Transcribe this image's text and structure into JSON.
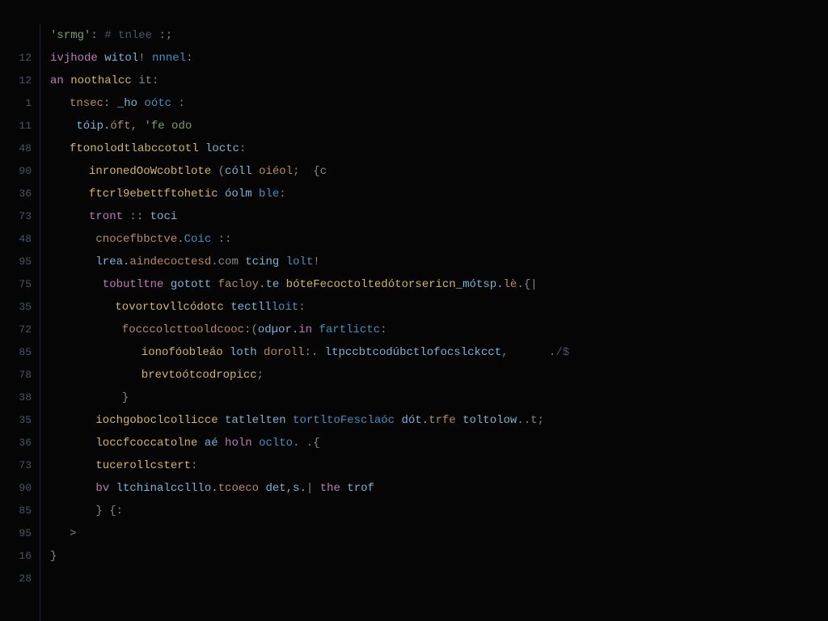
{
  "editor": {
    "line_numbers": [
      "",
      "12",
      "12",
      "1",
      "11",
      "48",
      "90",
      "36",
      "73",
      "48",
      "95",
      "75",
      "35",
      "72",
      "85",
      "78",
      "38",
      "35",
      "36",
      "73",
      "90",
      "85",
      "95",
      "16",
      "28"
    ],
    "lines": [
      {
        "indent": 0,
        "tokens": [
          {
            "t": "'srmg'",
            "c": "tk-string"
          },
          {
            "t": ": ",
            "c": "tk-punct"
          },
          {
            "t": "# tnlee",
            "c": "tk-comment"
          },
          {
            "t": " :;",
            "c": "tk-punct"
          }
        ]
      },
      {
        "indent": 0,
        "tokens": [
          {
            "t": "ivjhode ",
            "c": "tk-keyword"
          },
          {
            "t": "witol",
            "c": "tk-var"
          },
          {
            "t": "! ",
            "c": "tk-punct"
          },
          {
            "t": "nnnel",
            "c": "tk-type"
          },
          {
            "t": ":",
            "c": "tk-punct"
          }
        ]
      },
      {
        "indent": 0,
        "tokens": [
          {
            "t": "an ",
            "c": "tk-keyword"
          },
          {
            "t": "noothalcc",
            "c": "tk-func"
          },
          {
            "t": " it:",
            "c": "tk-punct"
          }
        ]
      },
      {
        "indent": 1,
        "tokens": [
          {
            "t": "tnsec: ",
            "c": "tk-prop"
          },
          {
            "t": "_ho ",
            "c": "tk-var"
          },
          {
            "t": "oótc",
            "c": "tk-type"
          },
          {
            "t": " :",
            "c": "tk-punct"
          }
        ]
      },
      {
        "indent": 1,
        "tokens": [
          {
            "t": " tóip.",
            "c": "tk-var"
          },
          {
            "t": "óft",
            "c": "tk-prop"
          },
          {
            "t": ", ",
            "c": "tk-punct"
          },
          {
            "t": "'fe odo",
            "c": "tk-string"
          }
        ]
      },
      {
        "indent": 1,
        "tokens": [
          {
            "t": "ftonolodtlabccototl ",
            "c": "tk-func"
          },
          {
            "t": "loctc",
            "c": "tk-var"
          },
          {
            "t": ":",
            "c": "tk-punct"
          }
        ]
      },
      {
        "indent": 2,
        "tokens": [
          {
            "t": "inronedOoWcobtlote ",
            "c": "tk-func"
          },
          {
            "t": "(",
            "c": "tk-punct"
          },
          {
            "t": "cóll ",
            "c": "tk-var"
          },
          {
            "t": "oiéol",
            "c": "tk-prop"
          },
          {
            "t": ";  {c",
            "c": "tk-punct"
          }
        ]
      },
      {
        "indent": 2,
        "tokens": [
          {
            "t": "ftcrl9ebettftohetic ",
            "c": "tk-func"
          },
          {
            "t": "óolm ",
            "c": "tk-var"
          },
          {
            "t": "ble",
            "c": "tk-type"
          },
          {
            "t": ":",
            "c": "tk-punct"
          }
        ]
      },
      {
        "indent": 2,
        "tokens": [
          {
            "t": "tront ",
            "c": "tk-keyword"
          },
          {
            "t": ":: ",
            "c": "tk-punct"
          },
          {
            "t": "toci",
            "c": "tk-var"
          }
        ]
      },
      {
        "indent": 2,
        "tokens": [
          {
            "t": " cnocefbbctve.",
            "c": "tk-prop"
          },
          {
            "t": "Coic",
            "c": "tk-type"
          },
          {
            "t": " ::",
            "c": "tk-punct"
          }
        ]
      },
      {
        "indent": 2,
        "tokens": [
          {
            "t": " lrea.",
            "c": "tk-var"
          },
          {
            "t": "aindecoctesd",
            "c": "tk-prop"
          },
          {
            "t": ".com ",
            "c": "tk-punct"
          },
          {
            "t": "tcing ",
            "c": "tk-var"
          },
          {
            "t": "lolt",
            "c": "tk-type"
          },
          {
            "t": "!",
            "c": "tk-punct"
          }
        ]
      },
      {
        "indent": 2,
        "tokens": [
          {
            "t": "  tobutltne ",
            "c": "tk-keyword"
          },
          {
            "t": "gotott ",
            "c": "tk-var"
          },
          {
            "t": "facloy.",
            "c": "tk-prop"
          },
          {
            "t": "te ",
            "c": "tk-var"
          },
          {
            "t": "bóteFecoctoltedótorsericn",
            "c": "tk-func"
          },
          {
            "t": "_mótsp.",
            "c": "tk-var"
          },
          {
            "t": "lè",
            "c": "tk-prop"
          },
          {
            "t": ".{|",
            "c": "tk-punct"
          }
        ]
      },
      {
        "indent": 3,
        "tokens": [
          {
            "t": " tovortovllcódotc ",
            "c": "tk-func"
          },
          {
            "t": "tectll",
            "c": "tk-var"
          },
          {
            "t": "loit",
            "c": "tk-type"
          },
          {
            "t": ":",
            "c": "tk-punct"
          }
        ]
      },
      {
        "indent": 3,
        "tokens": [
          {
            "t": "  focccolcttooldcooc:",
            "c": "tk-prop"
          },
          {
            "t": "(",
            "c": "tk-punct"
          },
          {
            "t": "odµor.",
            "c": "tk-var"
          },
          {
            "t": "in ",
            "c": "tk-keyword"
          },
          {
            "t": "fartlictc",
            "c": "tk-type"
          },
          {
            "t": ":",
            "c": "tk-punct"
          }
        ]
      },
      {
        "indent": 4,
        "tokens": [
          {
            "t": "  ionofóobleáo ",
            "c": "tk-func"
          },
          {
            "t": "loth ",
            "c": "tk-var"
          },
          {
            "t": "doroll:. ",
            "c": "tk-prop"
          },
          {
            "t": "ltpccbtcodúbctlofocslckcct",
            "c": "tk-var"
          },
          {
            "t": ",      .",
            "c": "tk-punct"
          },
          {
            "t": "/$",
            "c": "tk-comment"
          }
        ]
      },
      {
        "indent": 4,
        "tokens": [
          {
            "t": "  brevtoótcodropicc",
            "c": "tk-func"
          },
          {
            "t": ";",
            "c": "tk-punct"
          }
        ]
      },
      {
        "indent": 3,
        "tokens": [
          {
            "t": "  }",
            "c": "tk-punct"
          }
        ]
      },
      {
        "indent": 2,
        "tokens": [
          {
            "t": " iochgoboclcollicce ",
            "c": "tk-func"
          },
          {
            "t": "tatlelten ",
            "c": "tk-var"
          },
          {
            "t": "tortltoFesclaóc ",
            "c": "tk-type"
          },
          {
            "t": "dót.",
            "c": "tk-var"
          },
          {
            "t": "trfe ",
            "c": "tk-prop"
          },
          {
            "t": "toltolow",
            "c": "tk-var"
          },
          {
            "t": "..t;",
            "c": "tk-punct"
          }
        ]
      },
      {
        "indent": 2,
        "tokens": [
          {
            "t": " loccfcoccatolne ",
            "c": "tk-func"
          },
          {
            "t": "aé ",
            "c": "tk-var"
          },
          {
            "t": "holn ",
            "c": "tk-keyword"
          },
          {
            "t": "oclto",
            "c": "tk-type"
          },
          {
            "t": ". .{",
            "c": "tk-punct"
          }
        ]
      },
      {
        "indent": 2,
        "tokens": [
          {
            "t": " tucerollcstert",
            "c": "tk-func"
          },
          {
            "t": ":",
            "c": "tk-punct"
          }
        ]
      },
      {
        "indent": 2,
        "tokens": [
          {
            "t": " bv ",
            "c": "tk-keyword"
          },
          {
            "t": "ltchinalcclllo.",
            "c": "tk-var"
          },
          {
            "t": "tcoeco ",
            "c": "tk-prop"
          },
          {
            "t": "det,s.",
            "c": "tk-var"
          },
          {
            "t": "| ",
            "c": "tk-punct"
          },
          {
            "t": "the ",
            "c": "tk-keyword"
          },
          {
            "t": "trof",
            "c": "tk-var"
          }
        ]
      },
      {
        "indent": 2,
        "tokens": [
          {
            "t": " } ",
            "c": "tk-punct"
          },
          {
            "t": "{:",
            "c": "tk-punct"
          }
        ]
      },
      {
        "indent": 1,
        "tokens": [
          {
            "t": ">",
            "c": "tk-punct"
          }
        ]
      },
      {
        "indent": 0,
        "tokens": [
          {
            "t": "}",
            "c": "tk-punct"
          }
        ]
      },
      {
        "indent": 0,
        "tokens": []
      }
    ]
  }
}
